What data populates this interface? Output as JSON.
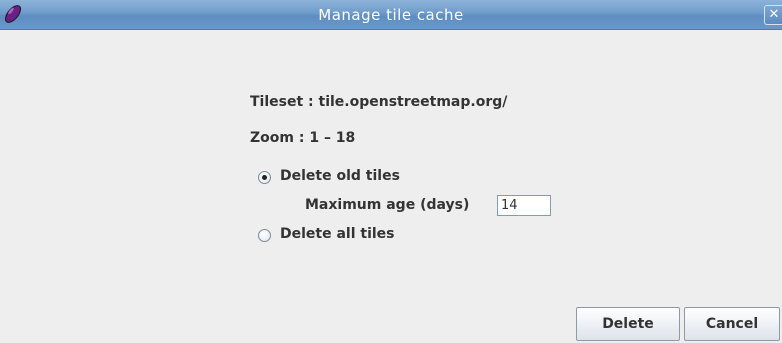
{
  "window": {
    "title": "Manage tile cache",
    "close_glyph": "✕",
    "icon": "app-logo-icon"
  },
  "info": {
    "tileset_label": "Tileset : tile.openstreetmap.org/",
    "zoom_label": "Zoom : 1 – 18"
  },
  "options": {
    "delete_old": {
      "label": "Delete old tiles",
      "selected": true
    },
    "max_age": {
      "label": "Maximum age (days)",
      "value": "14"
    },
    "delete_all": {
      "label": "Delete all tiles",
      "selected": false
    }
  },
  "buttons": {
    "delete": "Delete",
    "cancel": "Cancel"
  },
  "colors": {
    "titlebar": "#6f9bcb",
    "background": "#eeeeee",
    "text": "#333333"
  }
}
